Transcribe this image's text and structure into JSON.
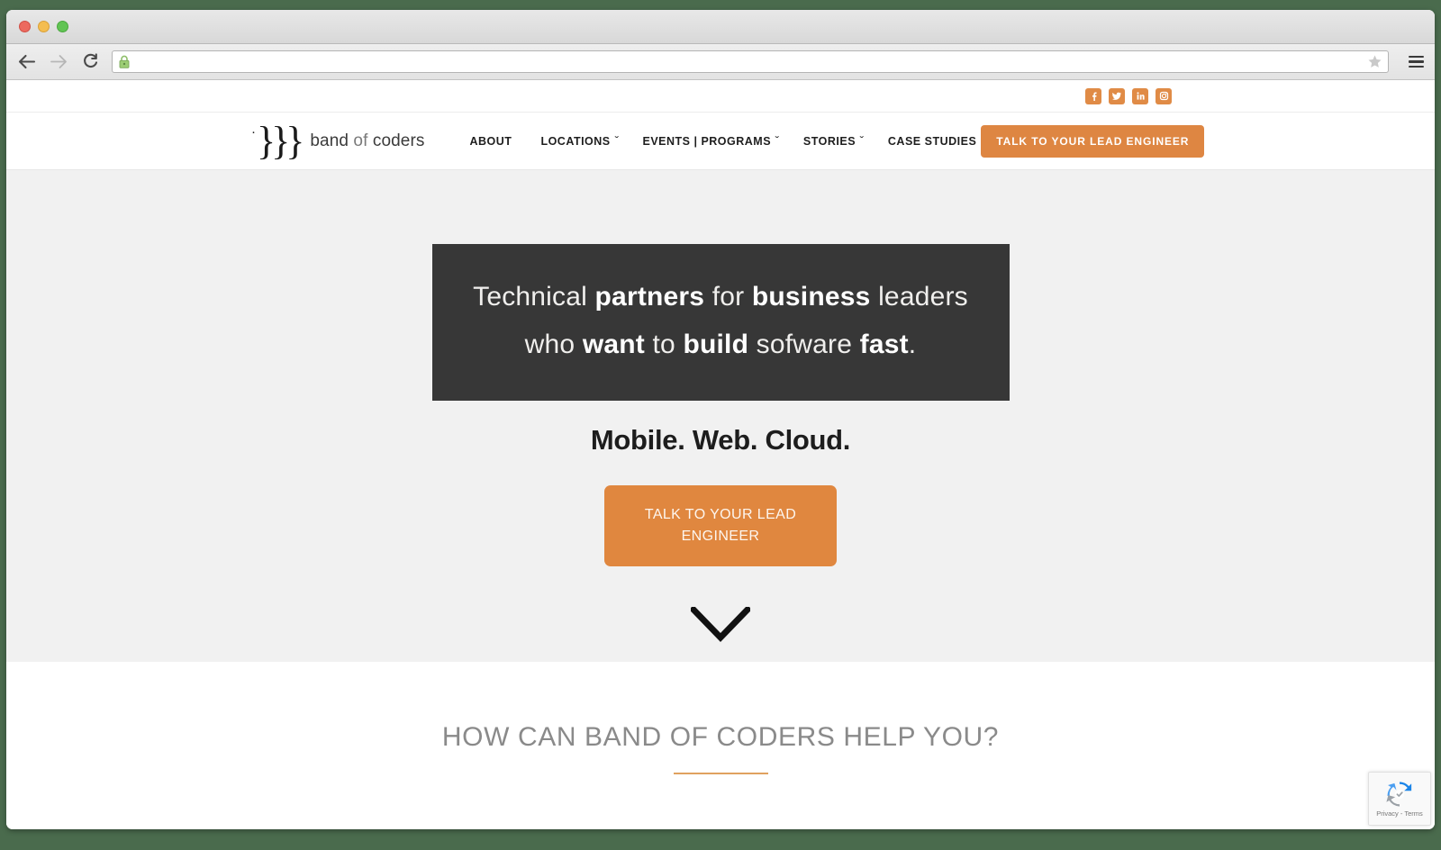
{
  "browser": {
    "back_icon": "back-arrow-icon",
    "forward_icon": "forward-arrow-icon",
    "reload_icon": "reload-icon",
    "lock_icon": "secure-lock-icon",
    "url": "",
    "url_placeholder": "",
    "bookmark_icon": "star-icon",
    "menu_icon": "hamburger-menu-icon"
  },
  "social": {
    "items": [
      {
        "name": "facebook",
        "label": "Facebook"
      },
      {
        "name": "twitter",
        "label": "Twitter"
      },
      {
        "name": "linkedin",
        "label": "LinkedIn"
      },
      {
        "name": "instagram",
        "label": "Instagram"
      }
    ],
    "color": "#e08b46"
  },
  "header": {
    "logo": {
      "mark": "}}}",
      "dot": "·",
      "text_1": "band",
      "text_2": "of",
      "text_3": "coders"
    },
    "nav": [
      {
        "label": "ABOUT",
        "caret": ""
      },
      {
        "label": "LOCATIONS",
        "caret": "ˇ"
      },
      {
        "label": "EVENTS | PROGRAMS",
        "caret": "ˇ"
      },
      {
        "label": "STORIES",
        "caret": "ˇ"
      },
      {
        "label": "CASE STUDIES",
        "caret": ""
      }
    ],
    "cta_label": "TALK TO YOUR LEAD ENGINEER",
    "cta_color": "#de8642"
  },
  "hero": {
    "headline_line1": {
      "p1": "Technical ",
      "b1": "partners",
      "p2": " for ",
      "b2": "business",
      "p3": " leaders"
    },
    "headline_line2": {
      "p1": "who ",
      "b1": "want",
      "p2": " to ",
      "b2": "build",
      "p3": " sofware ",
      "b3": "fast",
      "p4": "."
    },
    "subheadline": "Mobile. Web. Cloud.",
    "cta_label": "TALK TO YOUR LEAD ENGINEER",
    "cta_color": "#e0873f",
    "banner_bg": "#373737",
    "background": "#f1f1f1",
    "scroll_icon": "chevron-down-icon"
  },
  "help_section": {
    "heading": "HOW CAN BAND OF CODERS HELP YOU?",
    "rule_color": "#e0a15f"
  },
  "recaptcha": {
    "label": "Privacy - Terms",
    "icon": "recaptcha-logo-icon"
  }
}
